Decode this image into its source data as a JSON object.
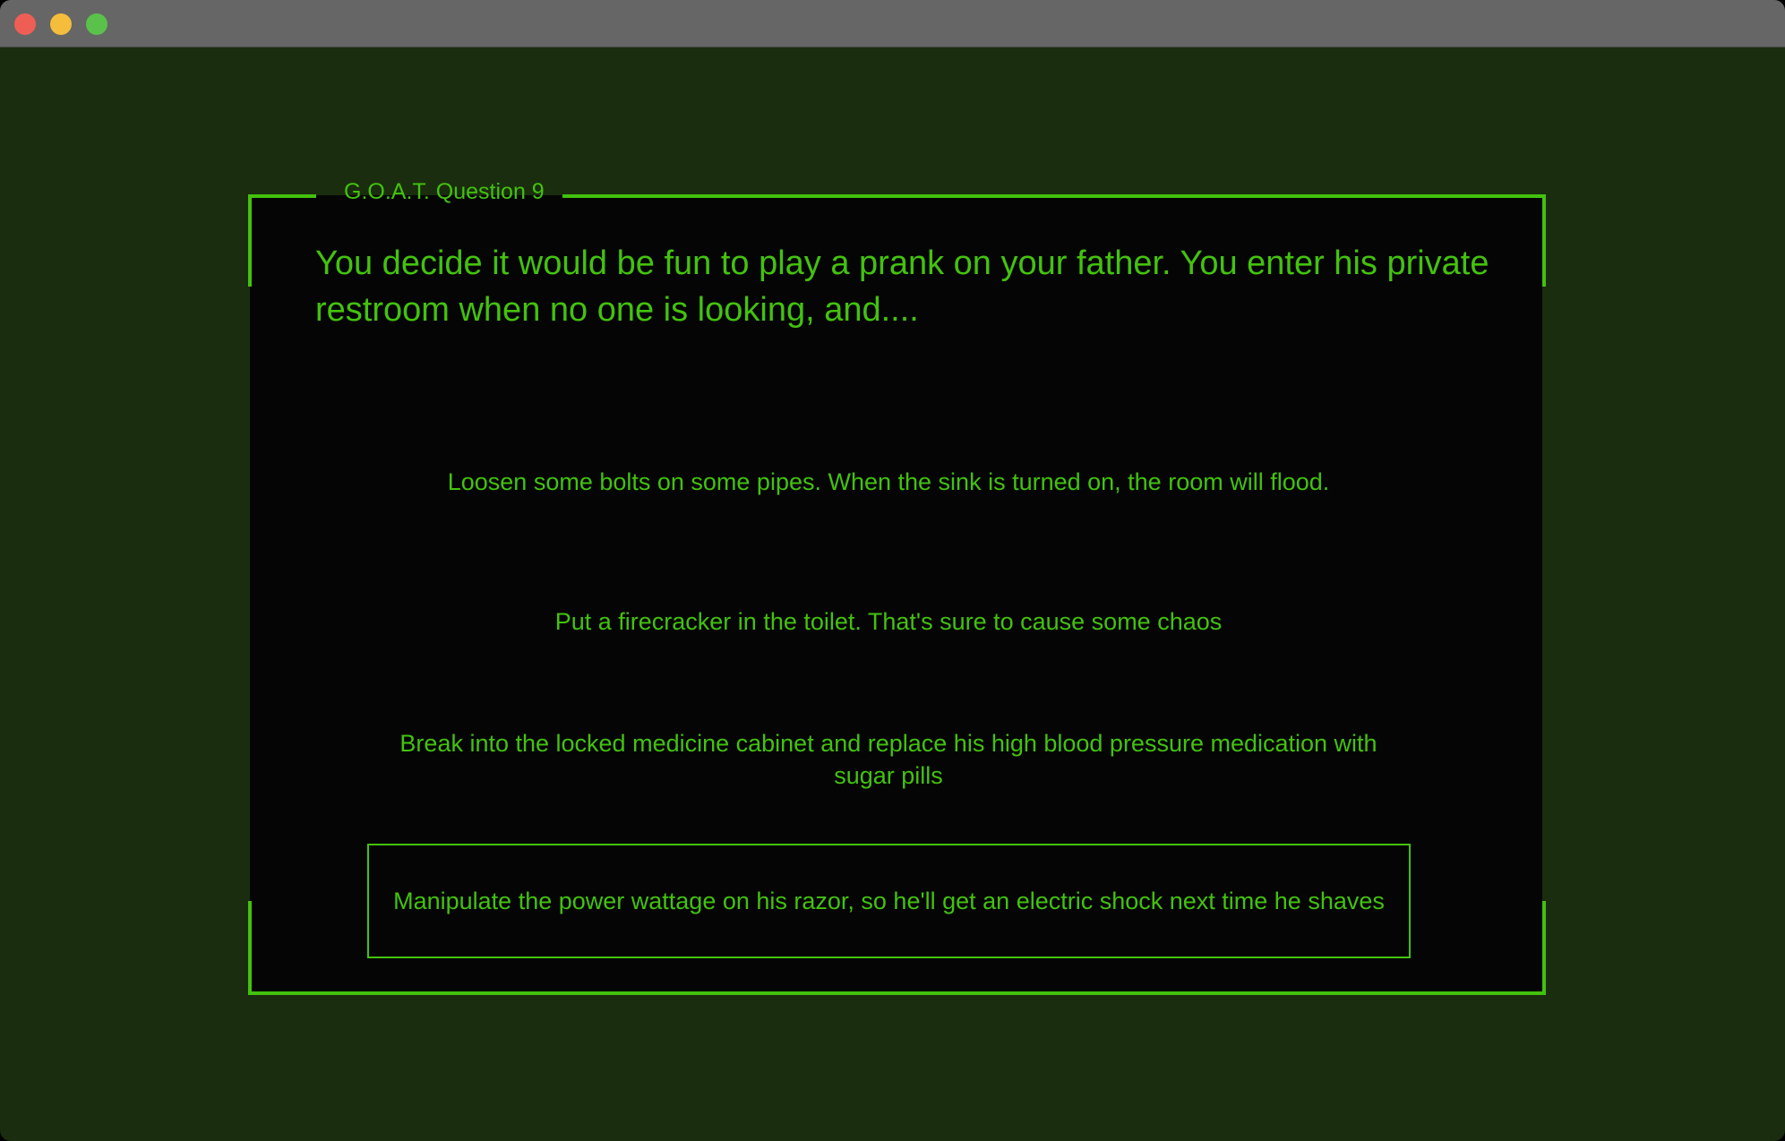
{
  "window": {
    "controls": [
      "close",
      "minimize",
      "zoom"
    ]
  },
  "quiz": {
    "legend": "G.O.A.T. Question 9",
    "question": "You decide it would be fun to play a prank on your father. You enter his private restroom when no one is looking, and....",
    "answers": [
      "Loosen some bolts on some pipes. When the sink is turned on, the room will flood.",
      "Put a firecracker in the toilet. That's sure to cause some chaos",
      "Break into the locked medicine cabinet and replace his high blood pressure medication with sugar pills",
      "Manipulate the power wattage on his razor, so he'll get an electric shock next time he shaves"
    ],
    "selected_index": 3
  },
  "colors": {
    "accent": "#43c20e",
    "window_background": "#1a2d0e",
    "panel_background": "#050505",
    "titlebar": "#666666"
  }
}
